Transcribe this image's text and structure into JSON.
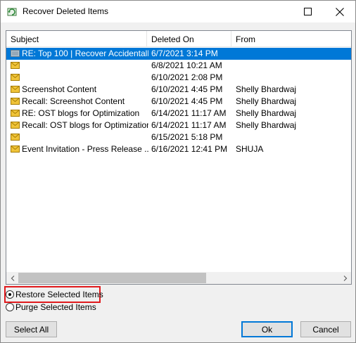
{
  "window": {
    "title": "Recover Deleted Items",
    "maximize_icon": "maximize-icon",
    "close_icon": "close-icon"
  },
  "list": {
    "columns": [
      "Subject",
      "Deleted On",
      "From"
    ],
    "rows": [
      {
        "subject": "RE: Top 100 | Recover Accidentall...",
        "deleted_on": "6/7/2021 3:14 PM",
        "from": "",
        "icon": "meeting-icon",
        "selected": true
      },
      {
        "subject": "",
        "deleted_on": "6/8/2021 10:21 AM",
        "from": "",
        "icon": "mail-icon",
        "selected": false
      },
      {
        "subject": "",
        "deleted_on": "6/10/2021 2:08 PM",
        "from": "",
        "icon": "mail-icon",
        "selected": false
      },
      {
        "subject": "Screenshot Content",
        "deleted_on": "6/10/2021 4:45 PM",
        "from": "Shelly Bhardwaj",
        "icon": "mail-icon",
        "selected": false
      },
      {
        "subject": "Recall: Screenshot Content",
        "deleted_on": "6/10/2021 4:45 PM",
        "from": "Shelly Bhardwaj",
        "icon": "mail-icon",
        "selected": false
      },
      {
        "subject": "RE: OST blogs for Optimization",
        "deleted_on": "6/14/2021 11:17 AM",
        "from": "Shelly Bhardwaj",
        "icon": "mail-icon",
        "selected": false
      },
      {
        "subject": "Recall: OST blogs for Optimization",
        "deleted_on": "6/14/2021 11:17 AM",
        "from": "Shelly Bhardwaj",
        "icon": "mail-icon",
        "selected": false
      },
      {
        "subject": "",
        "deleted_on": "6/15/2021 5:18 PM",
        "from": "",
        "icon": "mail-icon",
        "selected": false
      },
      {
        "subject": "Event Invitation - Press Release ...",
        "deleted_on": "6/16/2021 12:41 PM",
        "from": "SHUJA",
        "icon": "mail-icon",
        "selected": false
      }
    ]
  },
  "options": {
    "restore_label": "Restore Selected Items",
    "purge_label": "Purge Selected Items",
    "selected": "restore"
  },
  "buttons": {
    "select_all": "Select All",
    "ok": "Ok",
    "cancel": "Cancel"
  },
  "colors": {
    "selection": "#0078d7",
    "highlight_border": "#e0191c",
    "envelope": "#f0c43a"
  }
}
